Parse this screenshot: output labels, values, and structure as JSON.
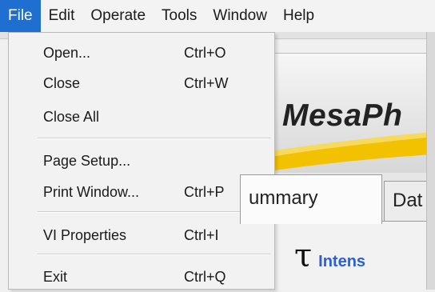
{
  "menubar": {
    "items": [
      {
        "label": "File"
      },
      {
        "label": "Edit"
      },
      {
        "label": "Operate"
      },
      {
        "label": "Tools"
      },
      {
        "label": "Window"
      },
      {
        "label": "Help"
      }
    ]
  },
  "file_menu": {
    "items": [
      {
        "label": "Open...",
        "shortcut": "Ctrl+O"
      },
      {
        "label": "Close",
        "shortcut": "Ctrl+W"
      },
      {
        "label": "Close All",
        "shortcut": ""
      },
      {
        "label": "Page Setup...",
        "shortcut": ""
      },
      {
        "label": "Print Window...",
        "shortcut": "Ctrl+P"
      },
      {
        "label": "VI Properties",
        "shortcut": "Ctrl+I"
      },
      {
        "label": "Exit",
        "shortcut": "Ctrl+Q"
      }
    ]
  },
  "app": {
    "banner_title": "MesaPh",
    "tabs": [
      {
        "label": "ummary"
      },
      {
        "label": "Dat"
      }
    ],
    "tau_symbol": "τ",
    "intensity_label": "Intens"
  },
  "colors": {
    "menu_highlight": "#1f6fd1",
    "banner_yellow": "#f2c200",
    "link_blue": "#2b5fd6"
  }
}
